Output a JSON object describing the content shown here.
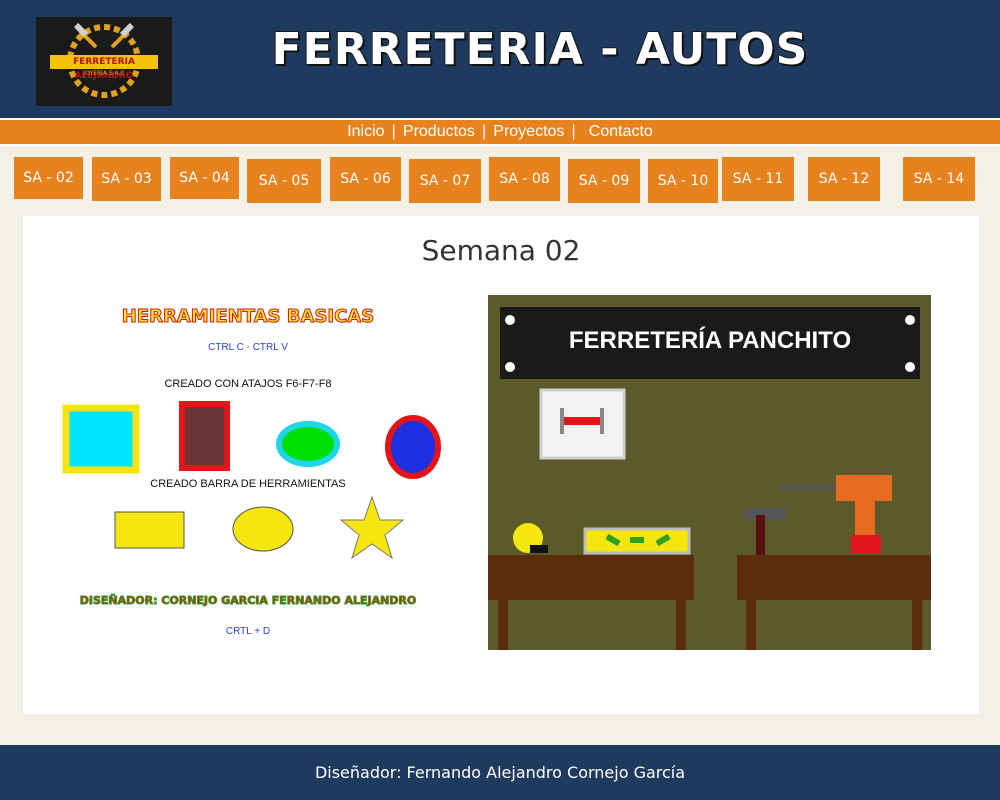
{
  "header": {
    "logo_text": "FERRETERIA ALEJANDRO",
    "logo_subtext": "JOYERIA S.A.C",
    "title": "FERRETERIA - AUTOS"
  },
  "nav": {
    "items": [
      "Inicio",
      "Productos",
      "Proyectos",
      "Contacto"
    ],
    "separator": "|"
  },
  "week_buttons": [
    "SA - 02",
    "SA - 03",
    "SA - 04",
    "SA - 05",
    "SA - 06",
    "SA - 07",
    "SA - 08",
    "SA - 09",
    "SA - 10",
    "SA - 11",
    "SA - 12",
    "SA - 14"
  ],
  "main": {
    "week_title": "Semana 02",
    "left_image": {
      "title": "HERRAMIENTAS BASICAS",
      "shortcut_1": "CTRL C - CTRL V",
      "caption_1": "CREADO CON ATAJOS  F6-F7-F8",
      "caption_2": "CREADO BARRA DE HERRAMIENTAS",
      "designer": "DISEÑADOR: CORNEJO GARCIA FERNANDO ALEJANDRO",
      "shortcut_2": "CRTL + D"
    },
    "right_image": {
      "sign": "FERRETERÍA PANCHITO",
      "wall_color": "#5b5a2a"
    }
  },
  "footer": {
    "text": "Diseñador: Fernando Alejandro Cornejo García"
  },
  "colors": {
    "header_bg": "#1f3a5f",
    "accent": "#e8821f",
    "page_bg": "#f3f1e6"
  }
}
